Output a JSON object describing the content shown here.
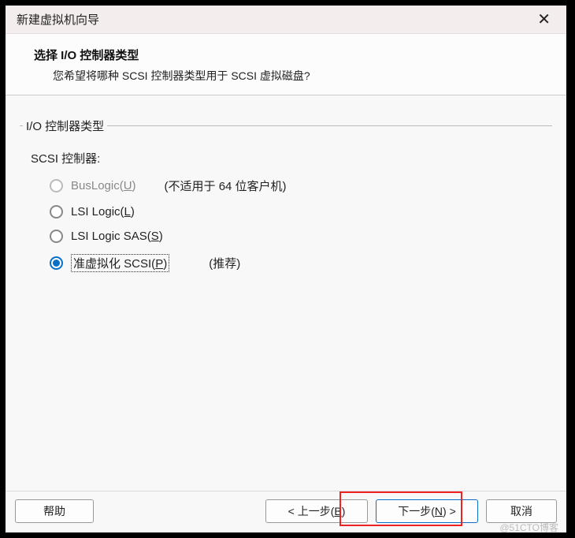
{
  "titlebar": {
    "title": "新建虚拟机向导"
  },
  "header": {
    "title": "选择 I/O 控制器类型",
    "description": "您希望将哪种 SCSI 控制器类型用于 SCSI 虚拟磁盘?"
  },
  "group": {
    "legend": "I/O 控制器类型",
    "scsi_label": "SCSI 控制器:"
  },
  "options": {
    "buslogic": {
      "label_pre": "BusLogic(",
      "mnemonic": "U",
      "label_post": ")",
      "hint": "(不适用于 64 位客户机)"
    },
    "lsilogic": {
      "label_pre": "LSI Logic(",
      "mnemonic": "L",
      "label_post": ")"
    },
    "lsisas": {
      "label_pre": "LSI Logic SAS(",
      "mnemonic": "S",
      "label_post": ")"
    },
    "pvscsi": {
      "label_pre": "准虚拟化 SCSI(",
      "mnemonic": "P",
      "label_post": ")",
      "hint": "(推荐)"
    }
  },
  "buttons": {
    "help": "帮助",
    "back_pre": "< 上一步(",
    "back_mn": "B",
    "back_post": ")",
    "next_pre": "下一步(",
    "next_mn": "N",
    "next_post": ") >",
    "cancel": "取消"
  },
  "watermark": "@51CTO博客"
}
